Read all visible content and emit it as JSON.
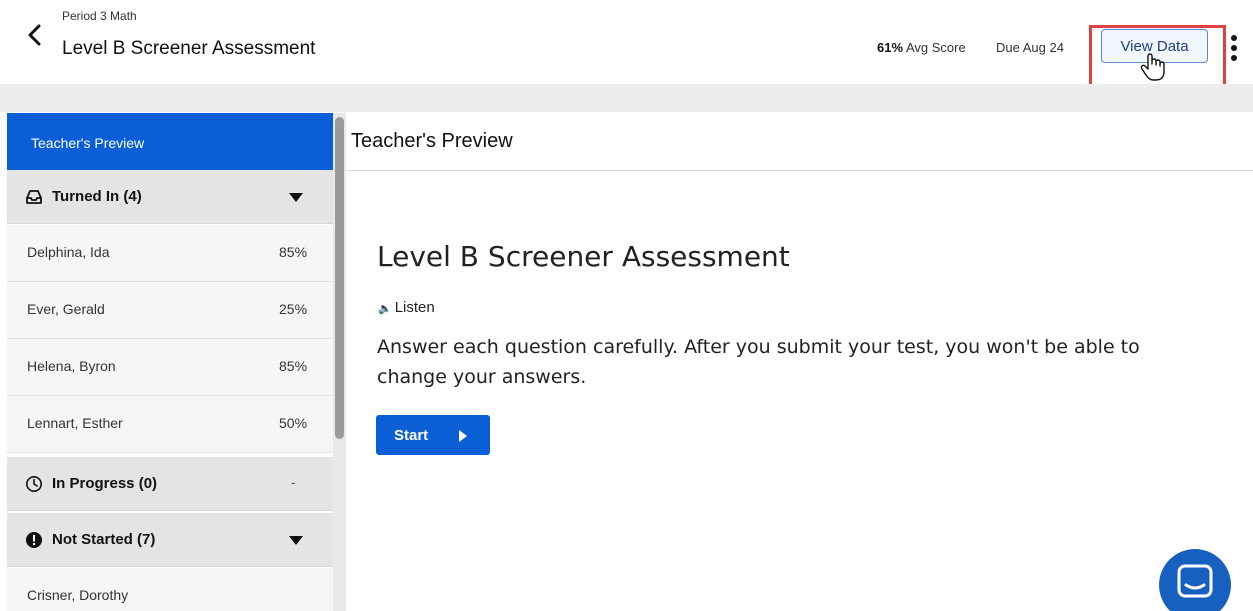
{
  "header": {
    "class_name": "Period 3 Math",
    "title": "Level B Screener Assessment",
    "avg_score_value": "61%",
    "avg_score_label": "Avg Score",
    "due": "Due Aug 24",
    "view_data_label": "View Data"
  },
  "sidebar": {
    "preview_label": "Teacher's Preview",
    "groups": {
      "turned_in": {
        "label": "Turned In (4)",
        "icon": "inbox-icon"
      },
      "in_progress": {
        "label": "In Progress (0)",
        "icon": "clock-icon",
        "empty_marker": "-"
      },
      "not_started": {
        "label": "Not Started (7)",
        "icon": "alert-circle-icon"
      }
    },
    "turned_in_students": [
      {
        "name": "Delphina, Ida",
        "score": "85%"
      },
      {
        "name": "Ever, Gerald",
        "score": "25%"
      },
      {
        "name": "Helena, Byron",
        "score": "85%"
      },
      {
        "name": "Lennart, Esther",
        "score": "50%"
      }
    ],
    "not_started_students": [
      {
        "name": "Crisner, Dorothy"
      }
    ]
  },
  "main": {
    "panel_title": "Teacher's Preview",
    "heading": "Level B Screener Assessment",
    "listen_label": "Listen",
    "instructions": "Answer each question carefully. After you submit your test, you won't be able to change your answers.",
    "start_label": "Start"
  },
  "colors": {
    "primary_blue": "#0b5fd6",
    "highlight_red": "#e0403f",
    "chat_blue": "#1860bf"
  }
}
